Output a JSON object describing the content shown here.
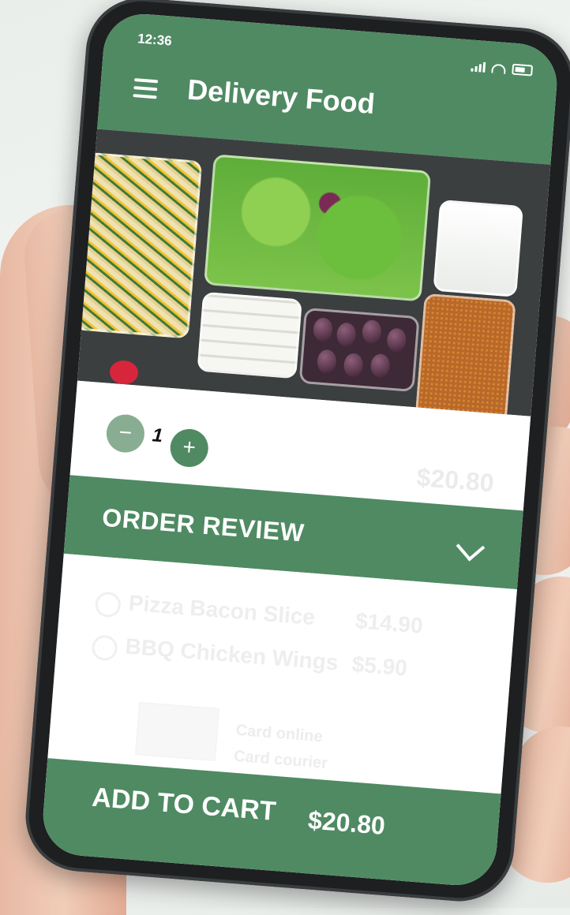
{
  "status_bar": {
    "time": "12:36"
  },
  "header": {
    "title": "Delivery Food"
  },
  "quantity": {
    "value": "1",
    "minus": "−",
    "plus": "+",
    "price": "$20.80"
  },
  "order_review": {
    "title": "ORDER REVIEW",
    "items": [
      {
        "name": "Pizza Bacon Slice",
        "price": "$14.90"
      },
      {
        "name": "BBQ Chicken Wings",
        "price": "$5.90"
      }
    ],
    "payment_options": [
      "Card online",
      "Card courier"
    ]
  },
  "cart": {
    "label": "ADD TO CART",
    "total": "$20.80"
  },
  "colors": {
    "accent": "#4f8a63",
    "accent_light": "#88ad92"
  }
}
